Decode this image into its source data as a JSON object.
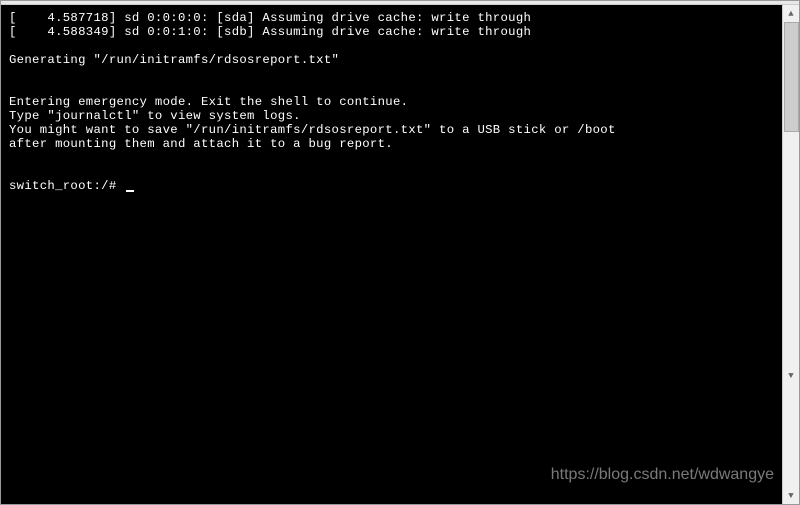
{
  "terminal": {
    "line1": "[    4.587718] sd 0:0:0:0: [sda] Assuming drive cache: write through",
    "line2": "[    4.588349] sd 0:0:1:0: [sdb] Assuming drive cache: write through",
    "line3": "",
    "line4": "Generating \"/run/initramfs/rdsosreport.txt\"",
    "line5": "",
    "line6": "",
    "line7": "Entering emergency mode. Exit the shell to continue.",
    "line8": "Type \"journalctl\" to view system logs.",
    "line9": "You might want to save \"/run/initramfs/rdsosreport.txt\" to a USB stick or /boot",
    "line10": "after mounting them and attach it to a bug report.",
    "line11": "",
    "line12": "",
    "prompt": "switch_root:/# "
  },
  "watermark": "https://blog.csdn.net/wdwangye",
  "scrollbar": {
    "up": "▲",
    "down": "▼"
  }
}
